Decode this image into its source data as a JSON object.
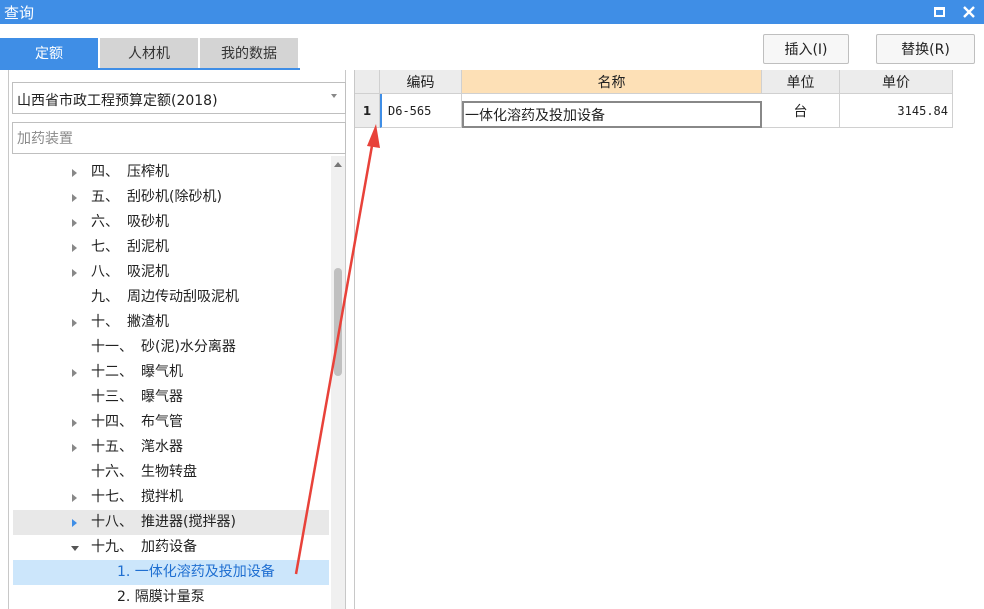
{
  "window": {
    "title": "查询"
  },
  "tabs": [
    {
      "label": "定额",
      "active": true
    },
    {
      "label": "人材机",
      "active": false
    },
    {
      "label": "我的数据",
      "active": false
    }
  ],
  "actions": {
    "insert": "插入(I)",
    "replace": "替换(R)"
  },
  "left": {
    "library": "山西省市政工程预算定额(2018)",
    "search_value": "加药装置",
    "tree": [
      {
        "num": "四、",
        "text": "压榨机",
        "arrow": "right"
      },
      {
        "num": "五、",
        "text": "刮砂机(除砂机)",
        "arrow": "right"
      },
      {
        "num": "六、",
        "text": "吸砂机",
        "arrow": "right"
      },
      {
        "num": "七、",
        "text": "刮泥机",
        "arrow": "right"
      },
      {
        "num": "八、",
        "text": "吸泥机",
        "arrow": "right"
      },
      {
        "num": "九、",
        "text": "周边传动刮吸泥机",
        "arrow": "none"
      },
      {
        "num": "十、",
        "text": "撇渣机",
        "arrow": "right"
      },
      {
        "num": "十一、",
        "text": "砂(泥)水分离器",
        "arrow": "none"
      },
      {
        "num": "十二、",
        "text": "曝气机",
        "arrow": "right"
      },
      {
        "num": "十三、",
        "text": "曝气器",
        "arrow": "none"
      },
      {
        "num": "十四、",
        "text": "布气管",
        "arrow": "right"
      },
      {
        "num": "十五、",
        "text": "滗水器",
        "arrow": "right"
      },
      {
        "num": "十六、",
        "text": "生物转盘",
        "arrow": "none"
      },
      {
        "num": "十七、",
        "text": "搅拌机",
        "arrow": "right"
      },
      {
        "num": "十八、",
        "text": "推进器(搅拌器)",
        "arrow": "right-blue",
        "state": "hover"
      },
      {
        "num": "十九、",
        "text": "加药设备",
        "arrow": "down"
      },
      {
        "num": "",
        "text": "1. 一体化溶药及投加设备",
        "arrow": "none",
        "state": "selected",
        "child": true
      },
      {
        "num": "",
        "text": "2. 隔膜计量泵",
        "arrow": "none",
        "child": true
      }
    ]
  },
  "grid": {
    "columns": [
      "编码",
      "名称",
      "单位",
      "单价"
    ],
    "rows": [
      {
        "num": "1",
        "code": "D6-565",
        "name": "一体化溶药及投加设备",
        "unit": "台",
        "price": "3145.84"
      }
    ]
  },
  "colors": {
    "accent": "#3f8ee6",
    "header_highlight": "#fde0b6",
    "selected_row": "#cce6fb",
    "annotation": "#e8423a"
  }
}
